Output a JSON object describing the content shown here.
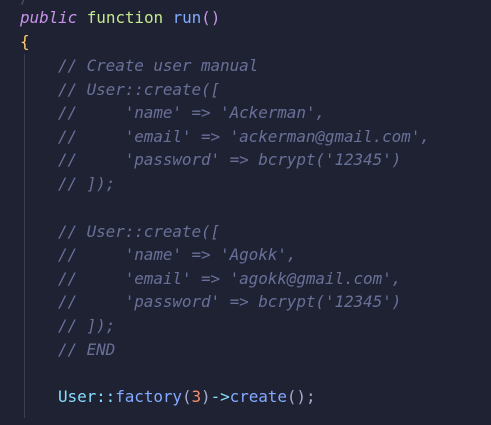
{
  "code": {
    "fragment_top": "/",
    "line1": {
      "keyword_public": "public",
      "keyword_function": "function",
      "fn_name": "run",
      "parens": "()"
    },
    "line2": {
      "open_brace": "{"
    },
    "comment1": {
      "l1": "// Create user manual",
      "l2": "// User::create([",
      "l3": "//     'name' => 'Ackerman',",
      "l4": "//     'email' => 'ackerman@gmail.com',",
      "l5": "//     'password' => bcrypt('12345')",
      "l6": "// ]);"
    },
    "comment2": {
      "l1": "// User::create([",
      "l2": "//     'name' => 'Agokk',",
      "l3": "//     'email' => 'agokk@gmail.com',",
      "l4": "//     'password' => bcrypt('12345')",
      "l5": "// ]);",
      "l6": "// END"
    },
    "factory_line": {
      "class": "User",
      "scope": "::",
      "method": "factory",
      "open_paren": "(",
      "arg": "3",
      "close_paren": ")",
      "arrow": "->",
      "method2": "create",
      "end": "();"
    }
  },
  "colors": {
    "background": "#1f2233",
    "comment": "#697098",
    "keyword": "#c792ea",
    "function": "#82aaff",
    "class": "#89ddff",
    "number": "#f78c6c",
    "brace": "#ffcb6b"
  }
}
